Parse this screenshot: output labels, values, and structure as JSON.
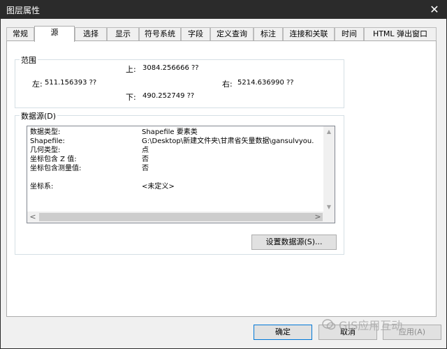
{
  "window": {
    "title": "图层属性"
  },
  "tabs": [
    {
      "label": "常规"
    },
    {
      "label": "源"
    },
    {
      "label": "选择"
    },
    {
      "label": "显示"
    },
    {
      "label": "符号系统"
    },
    {
      "label": "字段"
    },
    {
      "label": "定义查询"
    },
    {
      "label": "标注"
    },
    {
      "label": "连接和关联"
    },
    {
      "label": "时间"
    },
    {
      "label": "HTML 弹出窗口"
    }
  ],
  "active_tab": "源",
  "extent": {
    "group_label": "范围",
    "top_label": "上:",
    "top_value": "3084.256666 ??",
    "left_label": "左:",
    "left_value": "511.156393 ??",
    "right_label": "右:",
    "right_value": "5214.636990 ??",
    "bottom_label": "下:",
    "bottom_value": "490.252749 ??"
  },
  "data_source": {
    "group_label": "数据源(D)",
    "rows": [
      {
        "key": "数据类型:",
        "value": "Shapefile 要素类"
      },
      {
        "key": "Shapefile:",
        "value": "G:\\Desktop\\新建文件夹\\甘肃省矢量数据\\gansulvyou."
      },
      {
        "key": "几何类型:",
        "value": "点"
      },
      {
        "key": "坐标包含 Z 值:",
        "value": "否"
      },
      {
        "key": "坐标包含测量值:",
        "value": "否"
      },
      {
        "key": "",
        "value": ""
      },
      {
        "key": "坐标系:",
        "value": "<未定义>"
      }
    ],
    "set_source_button": "设置数据源(S)..."
  },
  "buttons": {
    "ok": "确定",
    "cancel": "取消",
    "apply": "应用(A)"
  },
  "watermark": {
    "text": "GIS应用互动"
  }
}
